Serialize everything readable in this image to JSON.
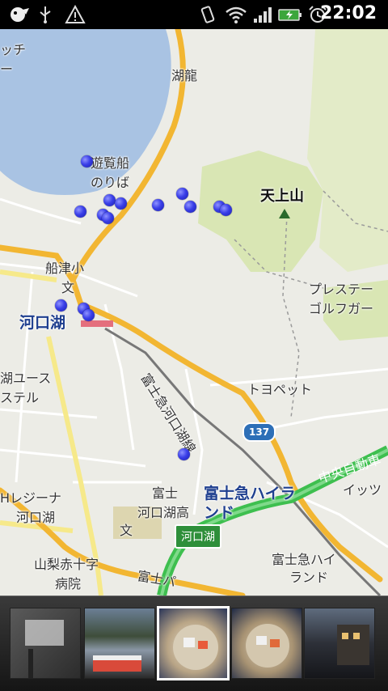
{
  "status_bar": {
    "time": "22:02",
    "icons": [
      "app-notification-icon",
      "usb-icon",
      "warning-icon",
      "vibrate-icon",
      "wifi-icon",
      "signal-icon",
      "battery-charging-icon",
      "alarm-icon"
    ]
  },
  "map": {
    "labels": {
      "lake_kawaguchi_station": "河口湖",
      "mt_tenjo": "天上山",
      "sightseeing_boat_line1": "遊覧船",
      "sightseeing_boat_line2": "のりば",
      "koryu": "湖龍",
      "funatsu_elem": "船津小",
      "school_symbol_1": "文",
      "school_symbol_2": "文",
      "fujikyu_line": "富士急河口湖線",
      "toyopet": "トヨペット",
      "route_137": "137",
      "chuo_expressway": "中央自動車",
      "highland_big": "富士急ハイランド",
      "highland_small_1": "富士急ハイ",
      "highland_small_2": "ランド",
      "fuji_kawaguchiko_high_1": "富士",
      "fuji_kawaguchiko_high_2": "河口湖高",
      "kawaguchiko_ic": "河口湖",
      "yamanashi_redcross_1": "山梨赤十字",
      "yamanashi_redcross_2": "病院",
      "h_regina_1": "Hレジーナ",
      "h_regina_2": "河口湖",
      "youth_hostel_1": "湖ユース",
      "youth_hostel_2": "ステル",
      "prestige_golf_1": "プレステー",
      "prestige_golf_2": "ゴルフガー",
      "fuji_pass": "富士パ",
      "ittsu": "イッツ",
      "top_left_1": "ッチ",
      "top_left_2": "ー"
    }
  },
  "filmstrip": {
    "thumbs": [
      {
        "name": "sign-photo",
        "caption": ""
      },
      {
        "name": "lake-bus-photo",
        "caption": ""
      },
      {
        "name": "hotpot-photo-1",
        "caption": ""
      },
      {
        "name": "hotpot-photo-2",
        "caption": ""
      },
      {
        "name": "night-street-photo",
        "caption": ""
      }
    ],
    "selected_index": 2
  },
  "colors": {
    "water": "#a9c3e3",
    "park": "#d9e6b4",
    "road_major": "#f2b632",
    "road_yellow": "#f6e98a",
    "expressway": "#3ebf4f",
    "marker": "#3a3fe8"
  }
}
